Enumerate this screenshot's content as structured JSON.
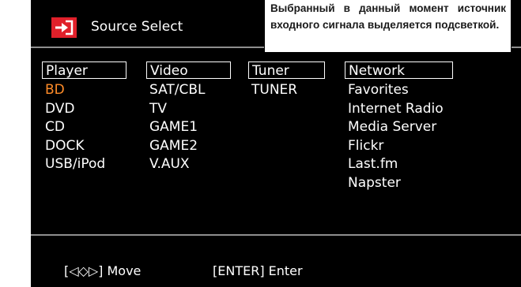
{
  "header": {
    "title": "Source Select",
    "icon": "source-input-icon",
    "icon_color": "#e0202a"
  },
  "columns": [
    {
      "label": "Player",
      "items": [
        "BD",
        "DVD",
        "CD",
        "DOCK",
        "USB/iPod"
      ]
    },
    {
      "label": "Video",
      "items": [
        "SAT/CBL",
        "TV",
        "GAME1",
        "GAME2",
        "V.AUX"
      ]
    },
    {
      "label": "Tuner",
      "items": [
        "TUNER"
      ]
    },
    {
      "label": "Network",
      "items": [
        "Favorites",
        "Internet Radio",
        "Media Server",
        "Flickr",
        "Last.fm",
        "Napster"
      ]
    }
  ],
  "selected": {
    "column": 0,
    "item": 0
  },
  "footer": {
    "move_hint": "[◁◇▷] Move",
    "enter_hint": "[ENTER] Enter"
  },
  "callout": {
    "text": "Выбранный в данный момент источник входного сигнала выделяется подсветкой."
  },
  "colors": {
    "screen_bg": "#000000",
    "text": "#ffffff",
    "highlight": "#ff8c28",
    "divider": "#8e8e8e"
  }
}
